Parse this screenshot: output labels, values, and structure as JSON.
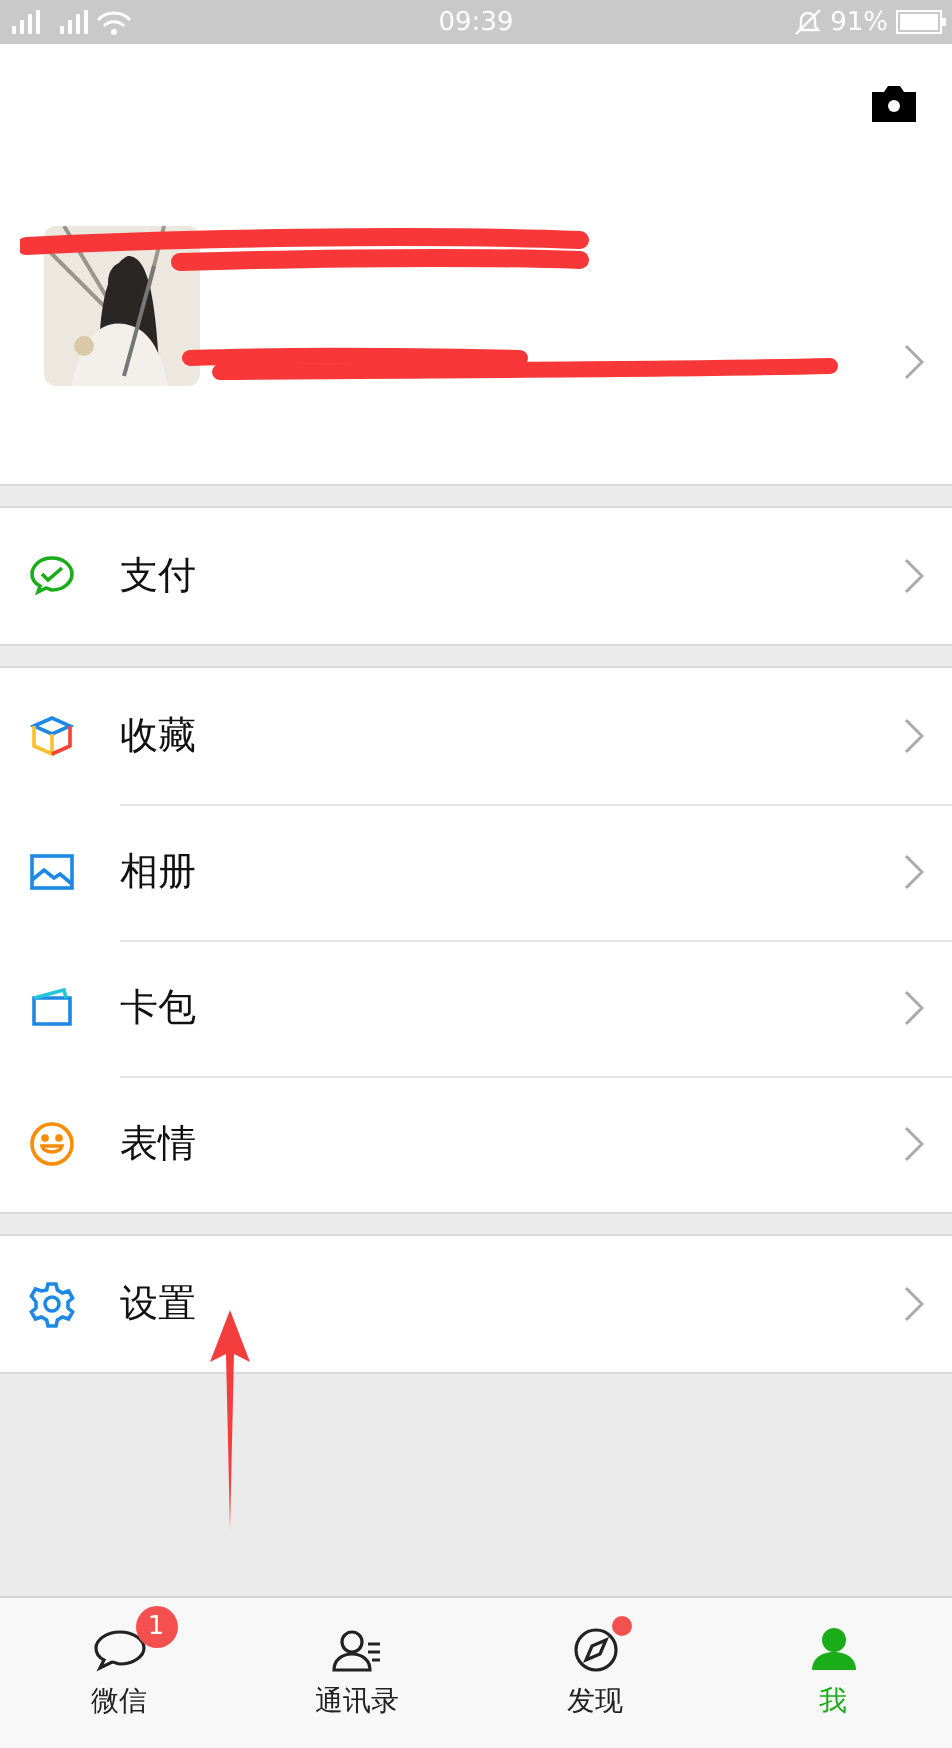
{
  "status_bar": {
    "time": "09:39",
    "battery": "91%"
  },
  "profile": {
    "redacted": true
  },
  "sections": [
    [
      {
        "kind": "pay",
        "label": "支付"
      }
    ],
    [
      {
        "kind": "favorites",
        "label": "收藏"
      },
      {
        "kind": "album",
        "label": "相册"
      },
      {
        "kind": "cards",
        "label": "卡包"
      },
      {
        "kind": "stickers",
        "label": "表情"
      }
    ],
    [
      {
        "kind": "settings",
        "label": "设置"
      }
    ]
  ],
  "tabs": [
    {
      "kind": "chats",
      "label": "微信",
      "selected": false,
      "badge": "1",
      "dot": false
    },
    {
      "kind": "contacts",
      "label": "通讯录",
      "selected": false,
      "dot": false
    },
    {
      "kind": "discover",
      "label": "发现",
      "selected": false,
      "dot": true
    },
    {
      "kind": "me",
      "label": "我",
      "selected": true,
      "dot": false
    }
  ]
}
